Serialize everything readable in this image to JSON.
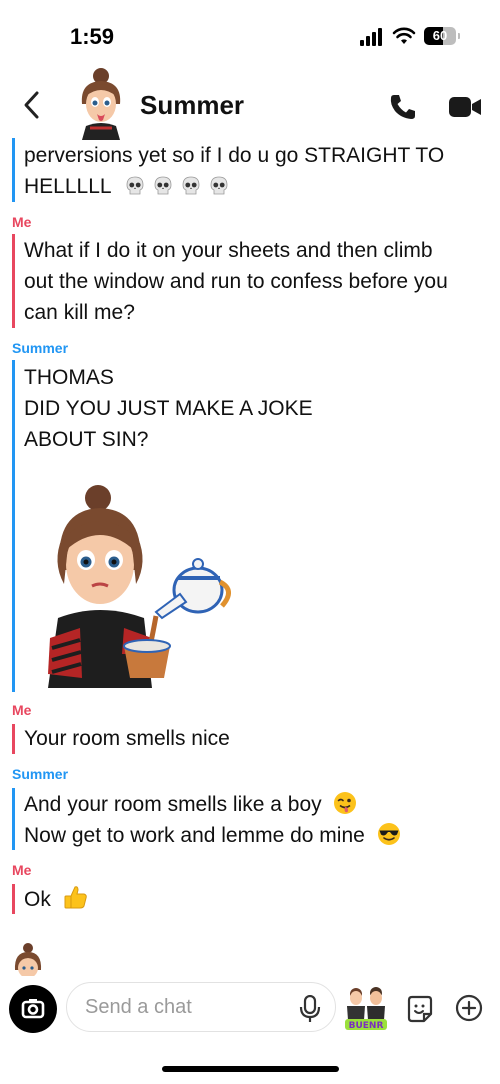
{
  "status_bar": {
    "time": "1:59",
    "battery": "60",
    "battery_level_pct": 60
  },
  "header": {
    "title": "Summer",
    "back_icon": "chevron-left-icon",
    "call_icon": "phone-icon",
    "video_icon": "video-camera-icon"
  },
  "messages": [
    {
      "lines": [
        "perversions yet so if I do u go STRAIGHT TO",
        "HELLLLL"
      ]
    },
    {
      "sender": "Me",
      "lines": [
        "What if I do it on your sheets and then climb",
        "out the window and run to confess before you",
        "can kill me?"
      ]
    },
    {
      "sender": "Summer",
      "lines": [
        "THOMAS",
        "DID YOU JUST MAKE A JOKE",
        "ABOUT SIN?"
      ]
    },
    {
      "sender": "Me",
      "lines": [
        "Your room smells nice"
      ]
    },
    {
      "sender": "Summer",
      "lines": [
        "And your room smells like a boy",
        "Now get to work and lemme do mine"
      ]
    },
    {
      "sender": "Me",
      "lines": [
        "Ok"
      ]
    }
  ],
  "emojis": {
    "skull": "skull-emoji",
    "wink": "winking-face-tongue-emoji",
    "sunglasses": "sunglasses-emoji",
    "thumbs": "thumbs-up-emoji"
  },
  "composer": {
    "placeholder": "Send a chat"
  },
  "colors": {
    "me": "#e8475f",
    "them": "#2196f3"
  }
}
